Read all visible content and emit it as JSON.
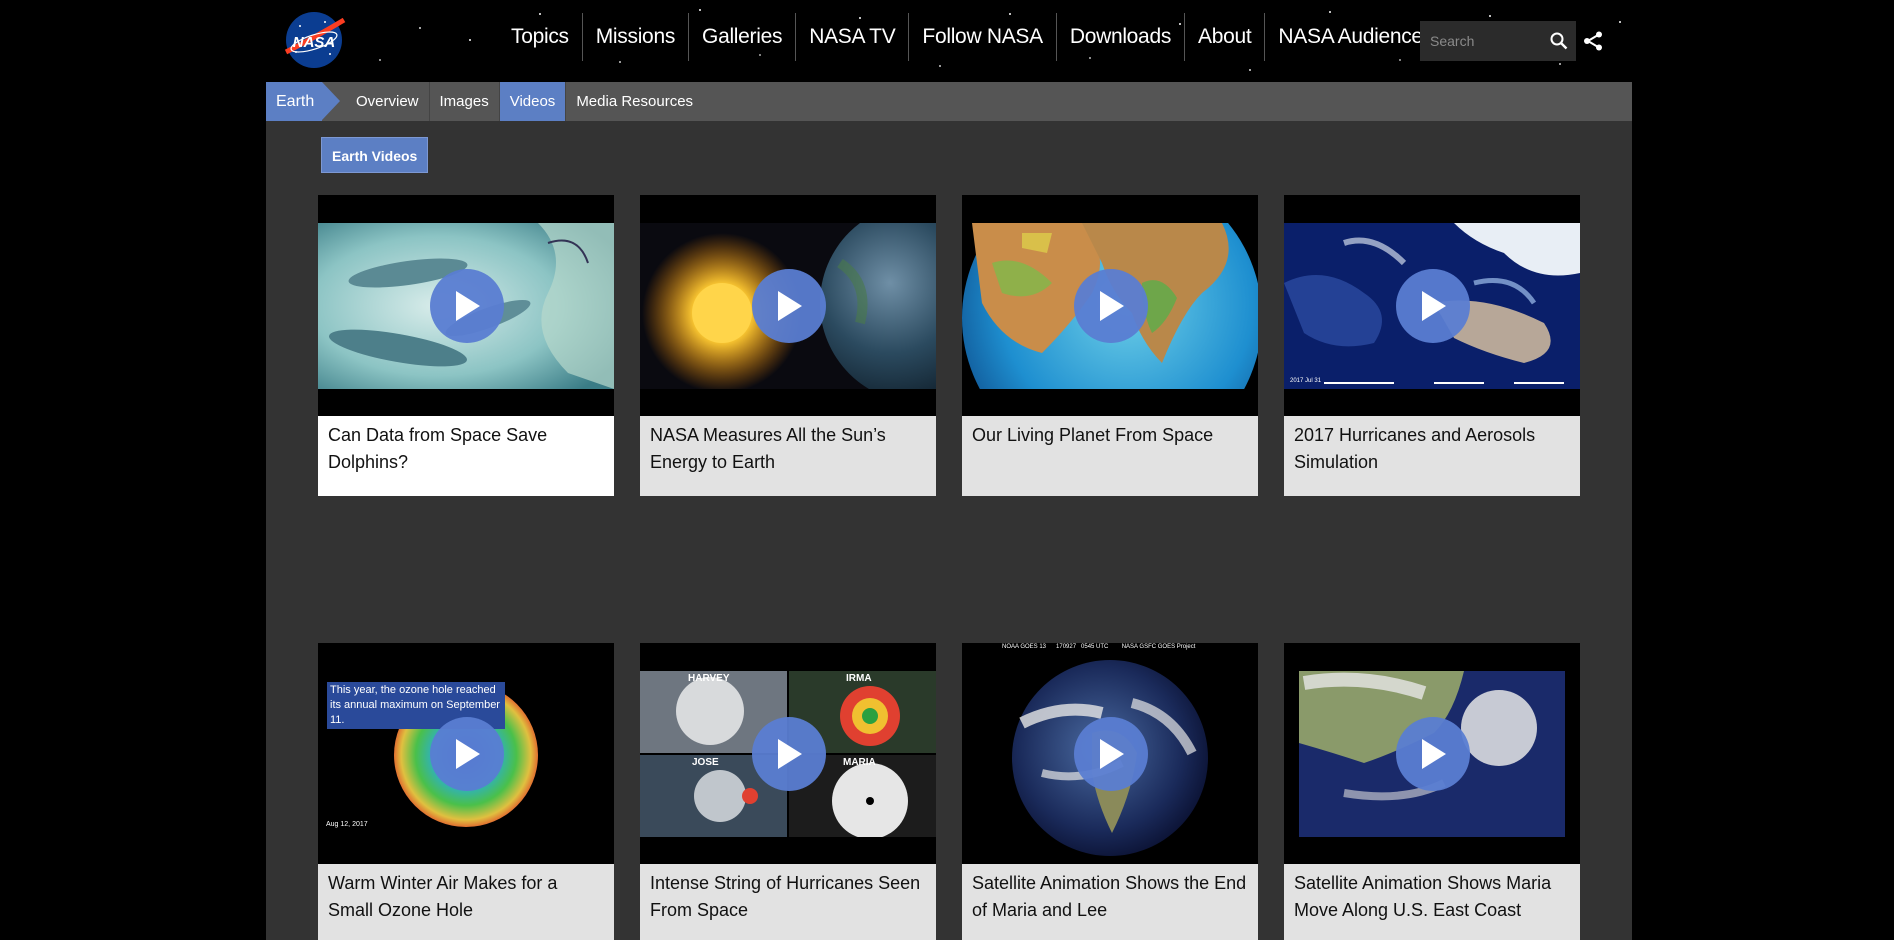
{
  "header": {
    "logo_text": "NASA",
    "nav": [
      "Topics",
      "Missions",
      "Galleries",
      "NASA TV",
      "Follow NASA",
      "Downloads",
      "About",
      "NASA Audiences"
    ],
    "search_placeholder": "Search"
  },
  "subnav": {
    "crumb": "Earth",
    "items": [
      "Overview",
      "Images",
      "Videos",
      "Media Resources"
    ],
    "active": "Videos"
  },
  "section_tag": "Earth Videos",
  "videos": [
    {
      "title": "Can Data from Space Save Dolphins?"
    },
    {
      "title": "NASA Measures All the Sun’s Energy to Earth"
    },
    {
      "title": "Our Living Planet From Space"
    },
    {
      "title": "2017 Hurricanes and Aerosols Simulation"
    },
    {
      "title": "Warm Winter Air Makes for a Small Ozone Hole"
    },
    {
      "title": "Intense String of Hurricanes Seen From Space"
    },
    {
      "title": "Satellite Animation Shows the End of Maria and Lee"
    },
    {
      "title": "Satellite Animation Shows Maria Move Along U.S. East Coast"
    }
  ],
  "thumb_text": {
    "ozone_caption": "This year, the ozone hole reached its annual maximum on September 11.",
    "ozone_date": "Aug 12, 2017",
    "hurricane_labels": [
      "HARVEY",
      "IRMA",
      "JOSE",
      "MARIA"
    ],
    "goes_banner": "NOAA GOES 13      170927   0545 UTC        NASA GSFC GOES Project",
    "aerosol_date": "2017 Jul 31"
  },
  "colors": {
    "accent": "#5c7fc4",
    "page_bg": "#333333",
    "subnav_bg": "#555555",
    "caption_bg": "#e2e2e2"
  },
  "icons": {
    "play": "play-icon",
    "search": "search-icon",
    "share": "share-icon"
  }
}
